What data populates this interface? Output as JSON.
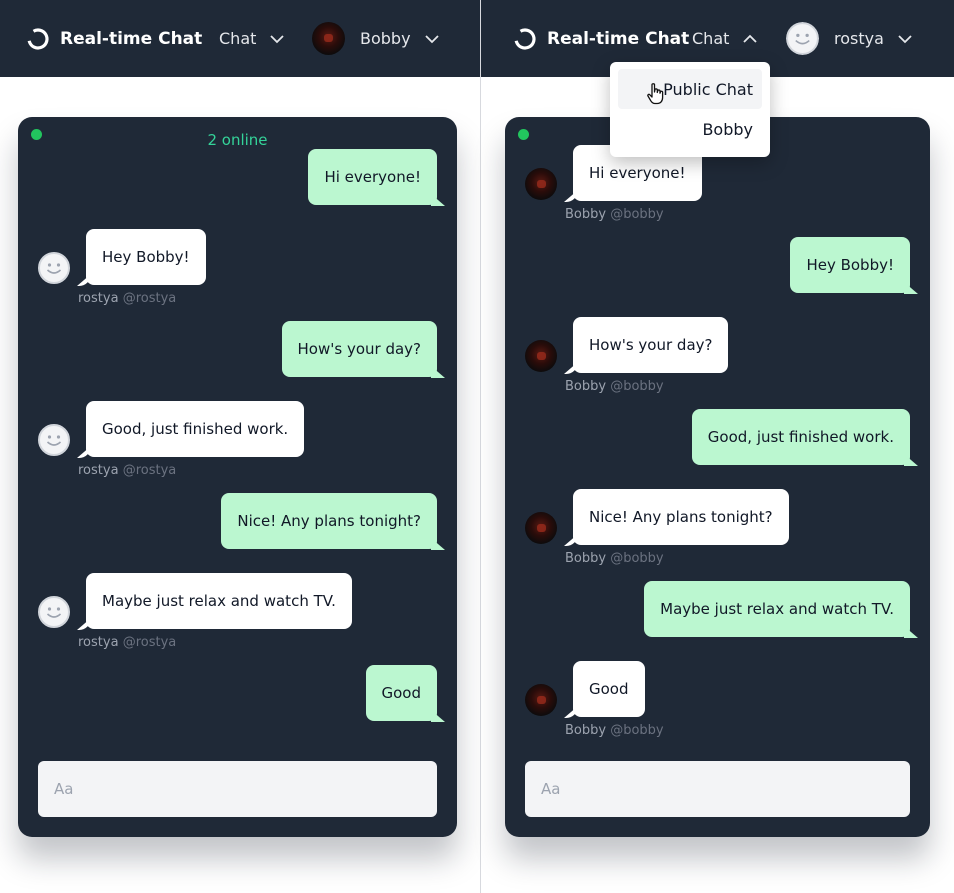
{
  "colors": {
    "navbar": "#1f2937",
    "card": "#1f2937",
    "outgoing": "#bbf7d0",
    "incoming": "#ffffff",
    "online": "#22c55e"
  },
  "left": {
    "app_title": "Real-time Chat",
    "nav_chat": "Chat",
    "user_name": "Bobby",
    "online_text": "2 online",
    "composer_placeholder": "Aa",
    "messages": [
      {
        "text": "Hi everyone!"
      },
      {
        "text": "Hey Bobby!",
        "author": "rostya",
        "handle": "@rostya"
      },
      {
        "text": "How's your day?"
      },
      {
        "text": "Good, just finished work.",
        "author": "rostya",
        "handle": "@rostya"
      },
      {
        "text": "Nice! Any plans tonight?"
      },
      {
        "text": "Maybe just relax and watch TV.",
        "author": "rostya",
        "handle": "@rostya"
      },
      {
        "text": "Good"
      }
    ]
  },
  "right": {
    "app_title": "Real-time Chat",
    "nav_chat": "Chat",
    "user_name": "rostya",
    "composer_placeholder": "Aa",
    "dropdown": [
      "Public Chat",
      "Bobby"
    ],
    "messages": [
      {
        "text": "Hi everyone!",
        "author": "Bobby",
        "handle": "@bobby"
      },
      {
        "text": "Hey Bobby!"
      },
      {
        "text": "How's your day?",
        "author": "Bobby",
        "handle": "@bobby"
      },
      {
        "text": "Good, just finished work."
      },
      {
        "text": "Nice! Any plans tonight?",
        "author": "Bobby",
        "handle": "@bobby"
      },
      {
        "text": "Maybe just relax and watch TV."
      },
      {
        "text": "Good",
        "author": "Bobby",
        "handle": "@bobby"
      }
    ]
  }
}
